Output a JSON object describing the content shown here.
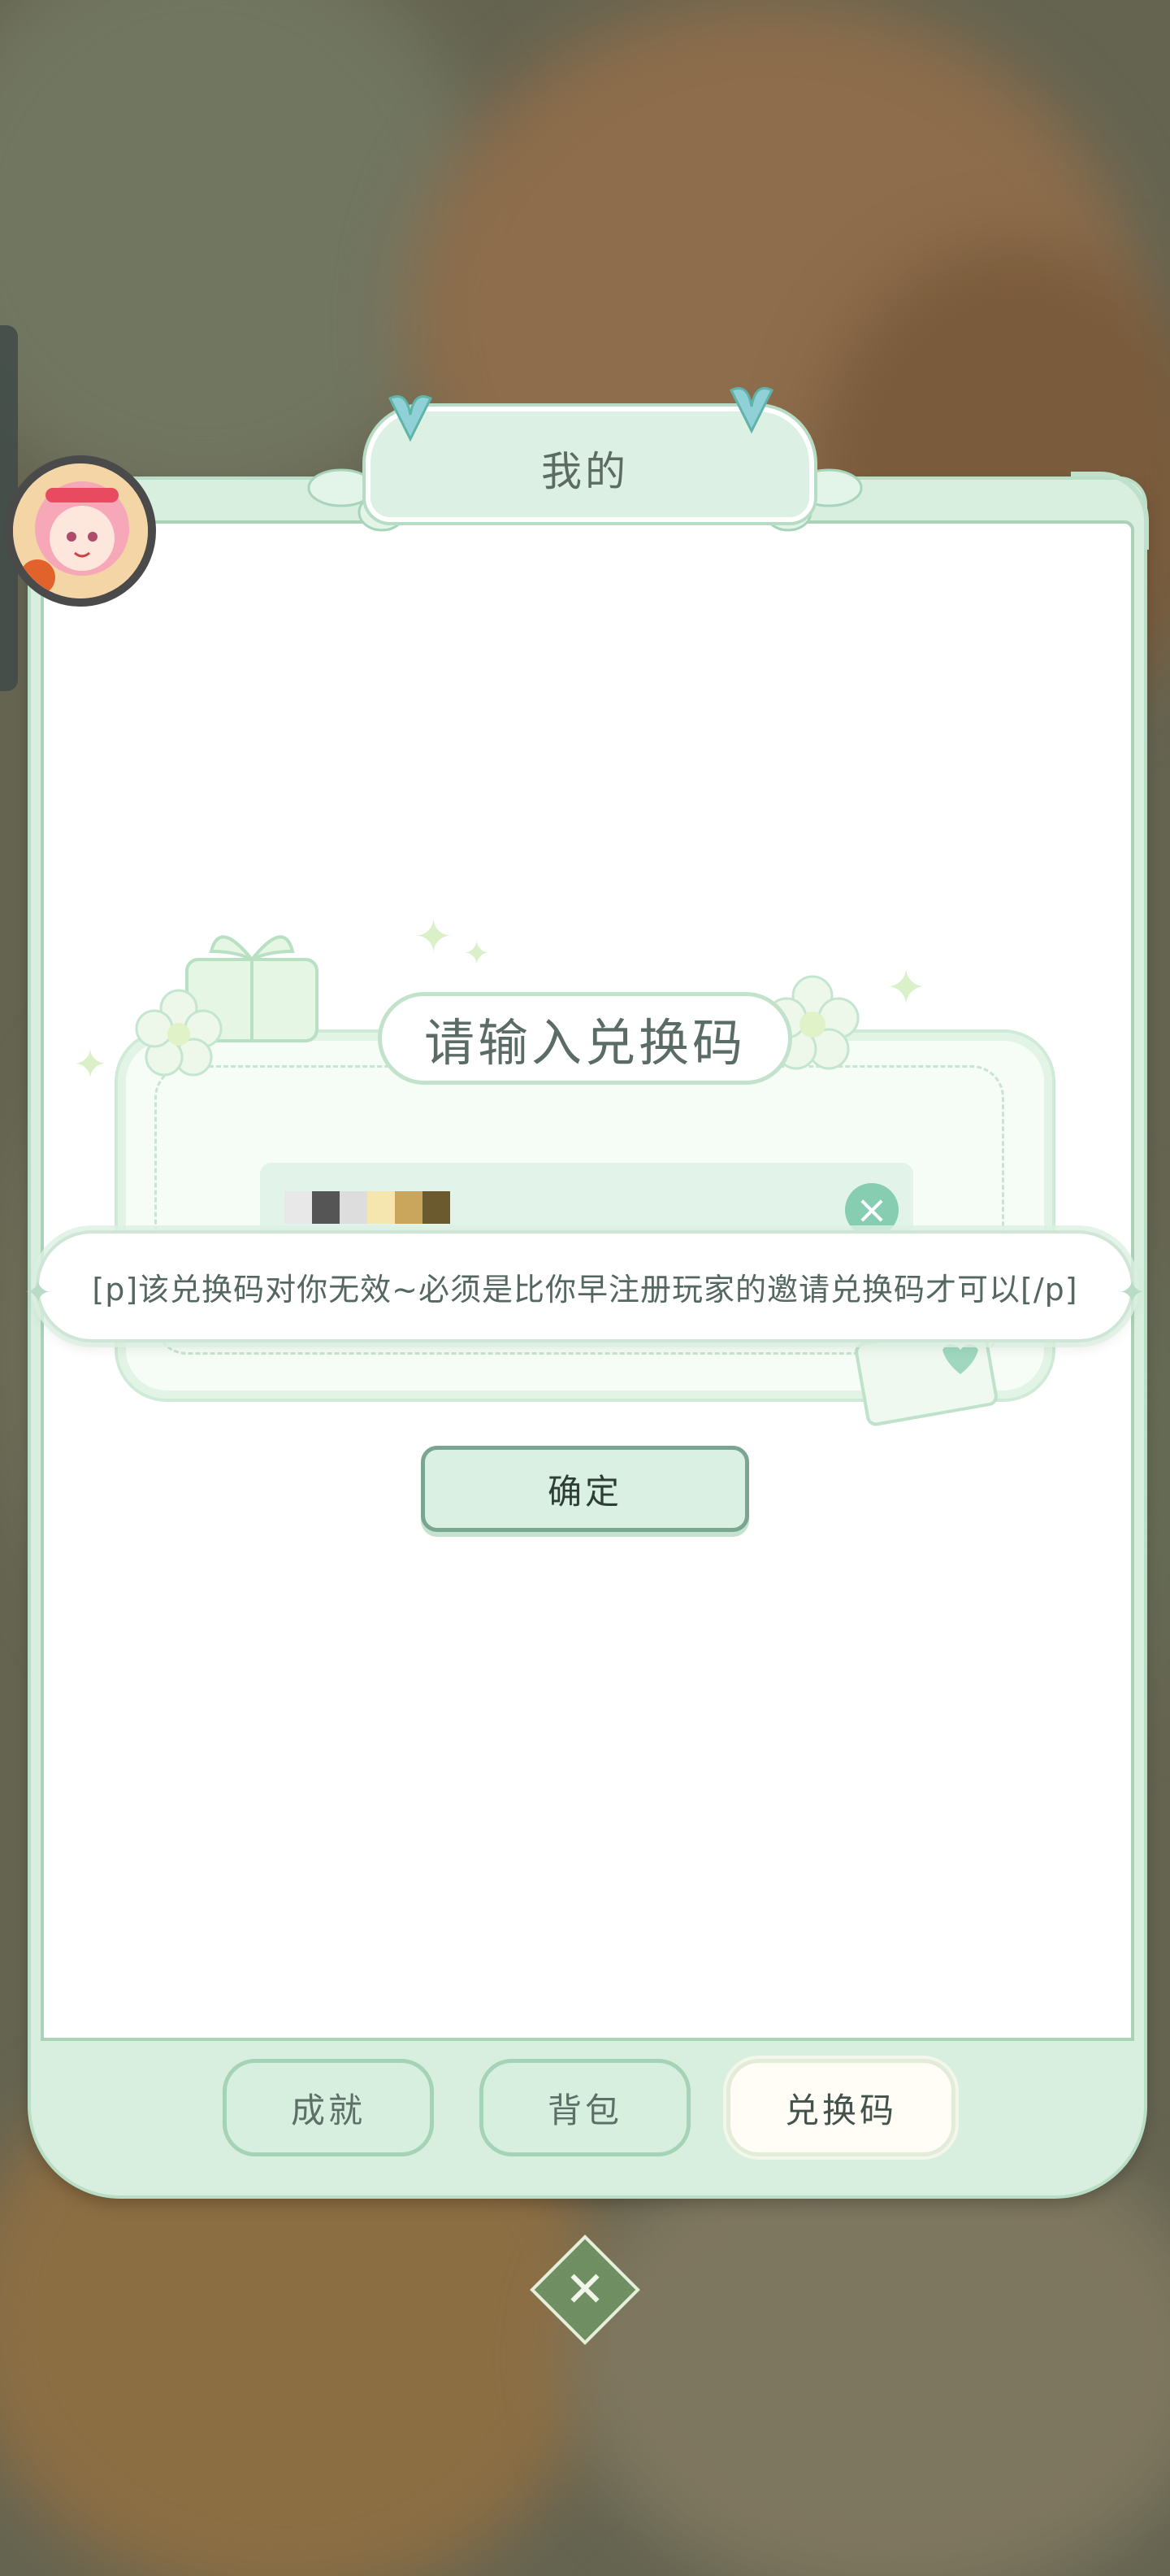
{
  "header": {
    "title": "我的"
  },
  "redeem": {
    "title": "请输入兑换码",
    "input_value": "",
    "confirm_label": "确定"
  },
  "toast": {
    "message": "[p]该兑换码对你无效~必须是比你早注册玩家的邀请兑换码才可以[/p]"
  },
  "tabs": [
    {
      "label": "成就",
      "active": false
    },
    {
      "label": "背包",
      "active": false
    },
    {
      "label": "兑换码",
      "active": true
    }
  ],
  "icons": {
    "close": "close-icon",
    "clear": "clear-input-icon",
    "butterfly": "butterfly-icon",
    "avatar": "player-avatar"
  },
  "colors": {
    "panel_bg": "#d8efdf",
    "accent_green": "#86cdb2",
    "text_dark": "#5a6c65"
  }
}
